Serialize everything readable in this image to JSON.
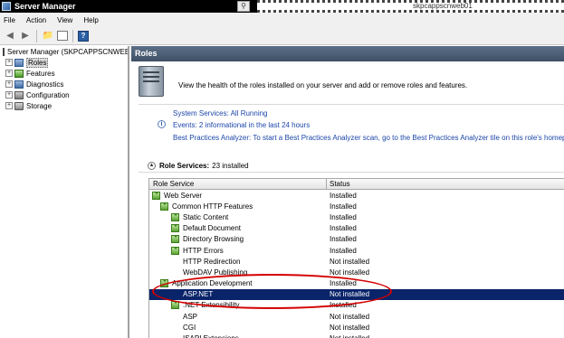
{
  "window": {
    "title": "Server Manager",
    "remote_host": "skpcappscnweb01",
    "remote_icon": "rdp-connection-icon"
  },
  "menu": [
    "File",
    "Action",
    "View",
    "Help"
  ],
  "toolbar": {
    "icons": [
      "back-arrow-icon",
      "forward-arrow-icon",
      "up-folder-icon",
      "show-hide-panel-icon",
      "help-icon"
    ],
    "help_glyph": "?"
  },
  "tree": {
    "root": "Server Manager (SKPCAPPSCNWEE",
    "items": [
      {
        "label": "Roles",
        "icon": "roles-icon",
        "selected": true
      },
      {
        "label": "Features",
        "icon": "features-icon"
      },
      {
        "label": "Diagnostics",
        "icon": "diagnostics-icon"
      },
      {
        "label": "Configuration",
        "icon": "configuration-icon"
      },
      {
        "label": "Storage",
        "icon": "storage-icon"
      }
    ]
  },
  "panel": {
    "header": "Roles",
    "description": "View the health of the roles installed on your server and add or remove roles and features.",
    "system_services": "System Services: All Running",
    "events": "Events: 2 informational in the last 24 hours",
    "bpa": "Best Practices Analyzer: To start a Best Practices Analyzer scan, go to the Best Practices Analyzer tile on this role's homepage"
  },
  "role_services": {
    "title": "Role Services:",
    "count": "23 installed",
    "columns": [
      "Role Service",
      "Status"
    ],
    "rows": [
      {
        "name": "Web Server",
        "status": "Installed",
        "indent": 0,
        "icon": "installed"
      },
      {
        "name": "Common HTTP Features",
        "status": "Installed",
        "indent": 1,
        "icon": "installed"
      },
      {
        "name": "Static Content",
        "status": "Installed",
        "indent": 2,
        "icon": "installed"
      },
      {
        "name": "Default Document",
        "status": "Installed",
        "indent": 2,
        "icon": "installed"
      },
      {
        "name": "Directory Browsing",
        "status": "Installed",
        "indent": 2,
        "icon": "installed"
      },
      {
        "name": "HTTP Errors",
        "status": "Installed",
        "indent": 2,
        "icon": "installed"
      },
      {
        "name": "HTTP Redirection",
        "status": "Not installed",
        "indent": 2,
        "icon": "none"
      },
      {
        "name": "WebDAV Publishing",
        "status": "Not installed",
        "indent": 2,
        "icon": "none"
      },
      {
        "name": "Application Development",
        "status": "Installed",
        "indent": 1,
        "icon": "installed"
      },
      {
        "name": "ASP.NET",
        "status": "Not installed",
        "indent": 2,
        "icon": "none",
        "selected": true
      },
      {
        "name": ".NET Extensibility",
        "status": "Installed",
        "indent": 2,
        "icon": "installed"
      },
      {
        "name": "ASP",
        "status": "Not installed",
        "indent": 2,
        "icon": "none"
      },
      {
        "name": "CGI",
        "status": "Not installed",
        "indent": 2,
        "icon": "none"
      },
      {
        "name": "ISAPI Extensions",
        "status": "Not installed",
        "indent": 2,
        "icon": "none"
      }
    ]
  },
  "annotation": {
    "color": "#d40000",
    "shape": "oval",
    "target": "ASP.NET"
  }
}
